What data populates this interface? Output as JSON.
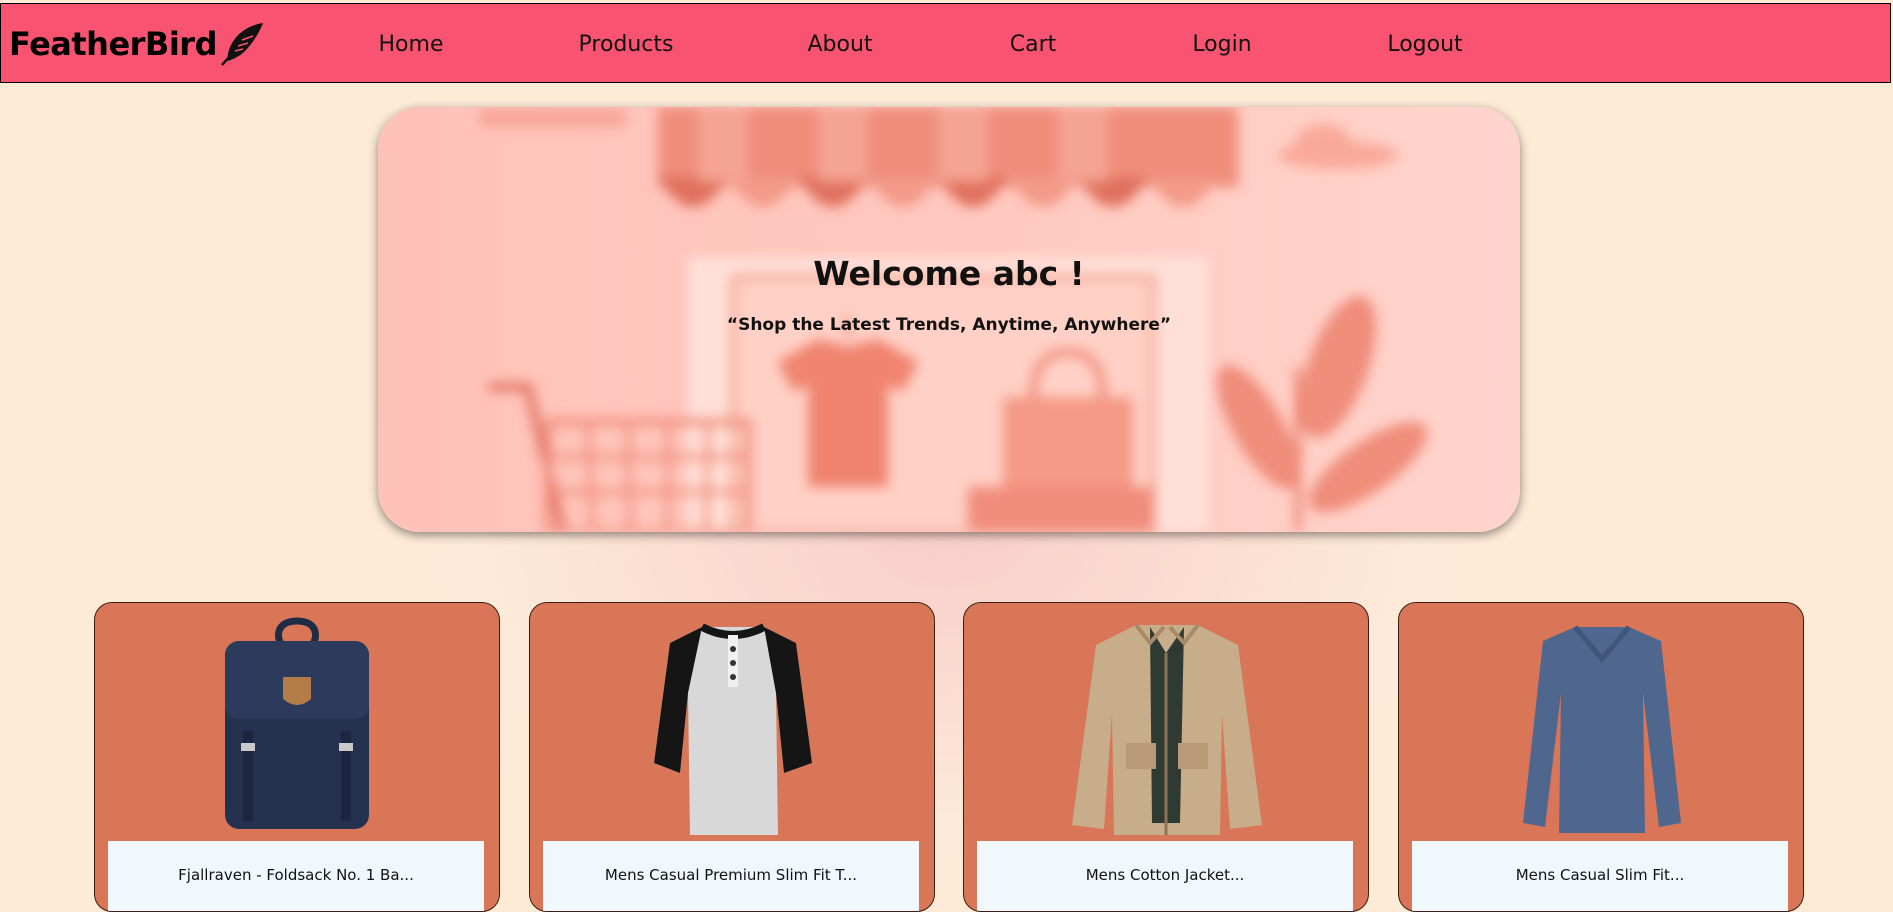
{
  "navbar": {
    "brand": "FeatherBird",
    "brand_icon": "feather-icon",
    "links": [
      "Home",
      "Products",
      "About",
      "Cart",
      "Login",
      "Logout"
    ]
  },
  "hero": {
    "title": "Welcome abc !",
    "subtitle": "“Shop the Latest Trends, Anytime, Anywhere”"
  },
  "products": [
    {
      "name": "Fjallraven - Foldsack No. 1 Ba...",
      "image": "backpack"
    },
    {
      "name": "Mens Casual Premium Slim Fit T...",
      "image": "raglan-henley-tshirt"
    },
    {
      "name": "Mens Cotton Jacket...",
      "image": "khaki-jacket"
    },
    {
      "name": "Mens Casual Slim Fit...",
      "image": "blue-longsleeve-tshirt"
    }
  ],
  "colors": {
    "navbar_bg": "#f85471",
    "card_bg": "#d97657",
    "card_label_bg": "#f0f7fd",
    "hero_bg": "#ffc8bf"
  }
}
